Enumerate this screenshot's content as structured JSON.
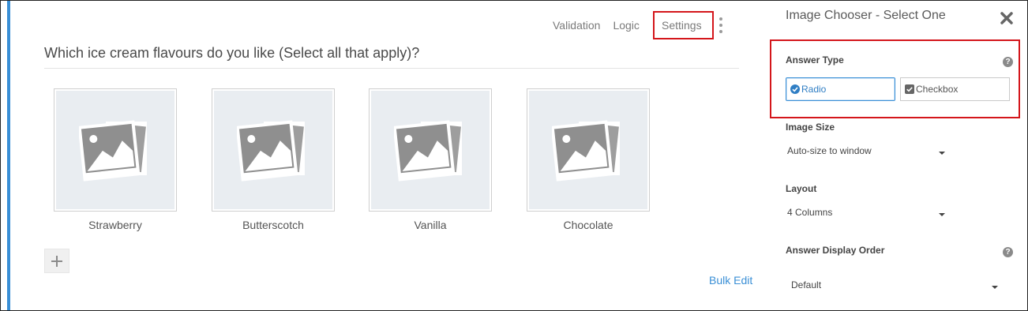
{
  "nav": {
    "tabs": [
      "Validation",
      "Logic"
    ],
    "settings_label": "Settings"
  },
  "question": {
    "text": "Which ice cream flavours do you like (Select all that apply)?",
    "choices": [
      {
        "label": "Strawberry"
      },
      {
        "label": "Butterscotch"
      },
      {
        "label": "Vanilla"
      },
      {
        "label": "Chocolate"
      }
    ],
    "bulk_edit_label": "Bulk Edit",
    "add_icon": "plus-icon"
  },
  "panel": {
    "title": "Image Chooser - Select One",
    "answer_type": {
      "label": "Answer Type",
      "options": [
        {
          "label": "Radio",
          "selected": true,
          "icon": "check-circle-icon"
        },
        {
          "label": "Checkbox",
          "selected": false,
          "icon": "checkbox-checked-icon"
        }
      ]
    },
    "image_size": {
      "label": "Image Size",
      "value": "Auto-size to window"
    },
    "layout": {
      "label": "Layout",
      "value": "4 Columns"
    },
    "display_order": {
      "label": "Answer Display Order",
      "value": "Default"
    }
  },
  "colors": {
    "accent": "#3a8fd6",
    "highlight_border": "#d4161b"
  }
}
